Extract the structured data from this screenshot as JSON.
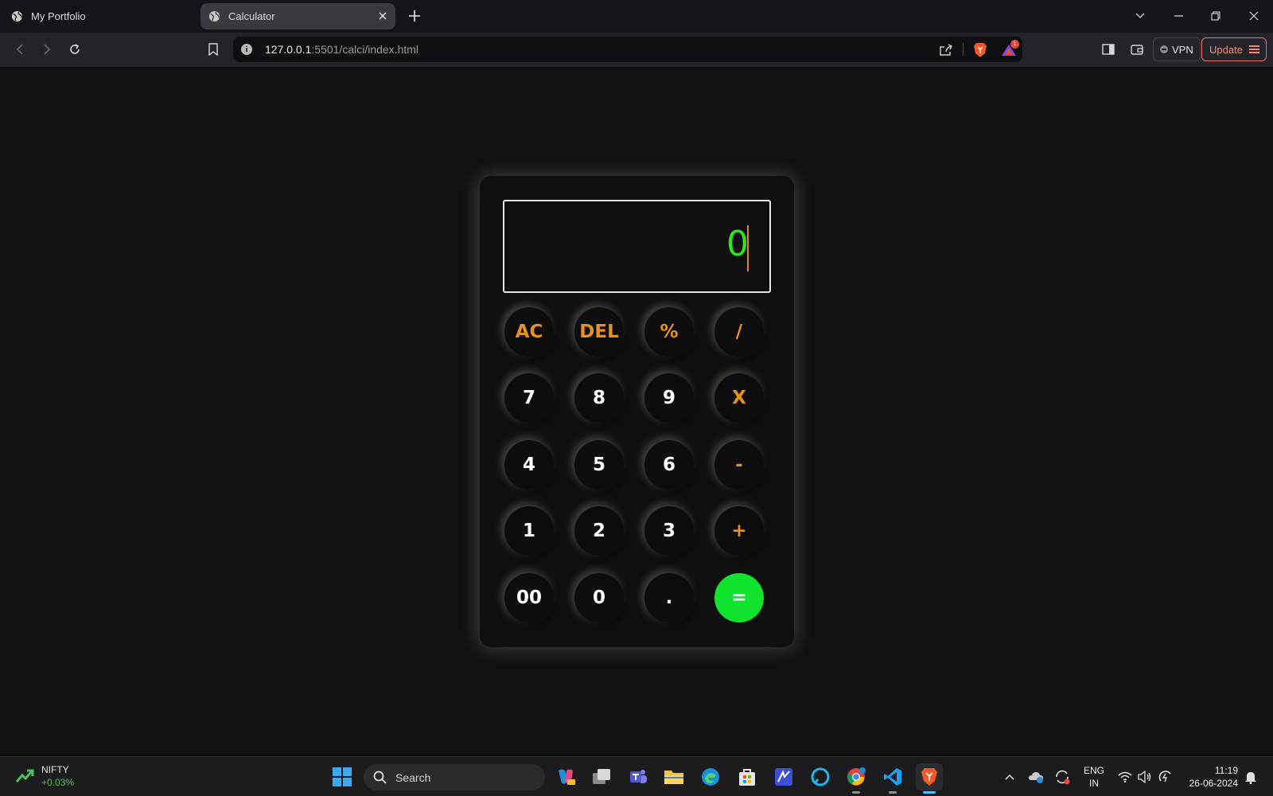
{
  "browser": {
    "tabs": [
      {
        "title": "My Portfolio",
        "active": false
      },
      {
        "title": "Calculator",
        "active": true
      }
    ],
    "url_host": "127.0.0.1",
    "url_rest": ":5501/calci/index.html",
    "notification_count": "1",
    "vpn_label": "VPN",
    "update_label": "Update"
  },
  "calculator": {
    "display_value": "0",
    "keys": [
      {
        "label": "AC",
        "kind": "op"
      },
      {
        "label": "DEL",
        "kind": "op"
      },
      {
        "label": "%",
        "kind": "op"
      },
      {
        "label": "/",
        "kind": "op"
      },
      {
        "label": "7",
        "kind": "digit"
      },
      {
        "label": "8",
        "kind": "digit"
      },
      {
        "label": "9",
        "kind": "digit"
      },
      {
        "label": "X",
        "kind": "op"
      },
      {
        "label": "4",
        "kind": "digit"
      },
      {
        "label": "5",
        "kind": "digit"
      },
      {
        "label": "6",
        "kind": "digit"
      },
      {
        "label": "-",
        "kind": "op"
      },
      {
        "label": "1",
        "kind": "digit"
      },
      {
        "label": "2",
        "kind": "digit"
      },
      {
        "label": "3",
        "kind": "digit"
      },
      {
        "label": "+",
        "kind": "op"
      },
      {
        "label": "00",
        "kind": "digit"
      },
      {
        "label": "0",
        "kind": "digit"
      },
      {
        "label": ".",
        "kind": "digit"
      },
      {
        "label": "=",
        "kind": "equals"
      }
    ],
    "colors": {
      "display_text": "#2fe41e",
      "operator": "#e8911c",
      "equals_bg": "#0fe32e"
    }
  },
  "taskbar": {
    "widget": {
      "name": "NIFTY",
      "change": "+0.03%"
    },
    "search_placeholder": "Search",
    "language": {
      "line1": "ENG",
      "line2": "IN"
    },
    "clock": {
      "time": "11:19",
      "date": "26-06-2024"
    }
  }
}
